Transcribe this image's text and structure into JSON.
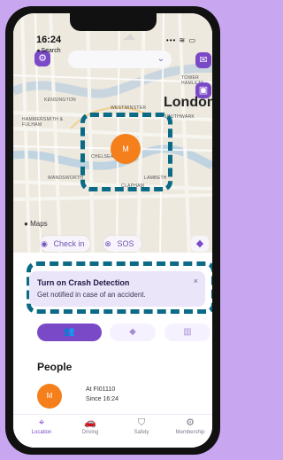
{
  "status": {
    "time": "16:24",
    "back": "◂ Search",
    "icons": "••• ≋ ▭"
  },
  "map": {
    "labels": [
      "WESTMINSTER",
      "SOUTHWARK",
      "KENSINGTON",
      "HAMMERSMITH & FULHAM",
      "WANDSWORTH",
      "LAMBETH",
      "CHELSEA",
      "CLAPHAM",
      "TOWER HAMLETS"
    ],
    "city": "London",
    "credit": "Maps"
  },
  "search": {
    "placeholder": ""
  },
  "avatar_initial": "M",
  "actions": {
    "check_in": "Check in",
    "sos": "SOS"
  },
  "crash": {
    "title": "Turn on Crash Detection",
    "subtitle": "Get notified in case of an accident."
  },
  "people": {
    "title": "People",
    "person_name": "At FI01110",
    "since": "Since 16:24"
  },
  "nav": [
    {
      "label": "Location",
      "icon": "map-pin-icon"
    },
    {
      "label": "Driving",
      "icon": "car-icon"
    },
    {
      "label": "Safety",
      "icon": "shield-icon"
    },
    {
      "label": "Membership",
      "icon": "settings-icon"
    }
  ],
  "colors": {
    "accent": "#7a49c7",
    "avatar": "#f47f1b",
    "annotation": "#0b6a86",
    "background": "#c9a7f0"
  }
}
